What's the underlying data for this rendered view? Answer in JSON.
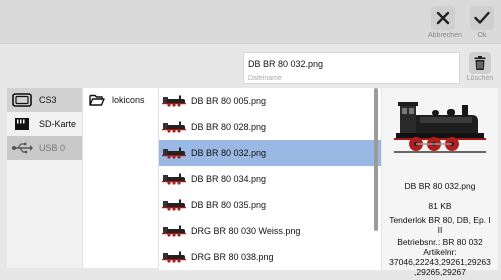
{
  "toolbar": {
    "cancel_label": "Abbrechen",
    "ok_label": "Ok"
  },
  "filename": {
    "value": "DB BR 80 032.png",
    "placeholder": "Dateiname",
    "delete_label": "Löschen"
  },
  "drives": [
    {
      "label": "CS3",
      "icon": "cs3-device-icon",
      "selected": true
    },
    {
      "label": "SD-Karte",
      "icon": "sd-card-icon"
    },
    {
      "label": "USB 0",
      "icon": "usb-icon",
      "disabled": true
    }
  ],
  "folders": [
    {
      "label": "lokicons",
      "icon": "folder-open-icon"
    }
  ],
  "files": [
    {
      "label": "DB BR 80 005.png"
    },
    {
      "label": "DB BR 80 028.png"
    },
    {
      "label": "DB BR 80 032.png",
      "selected": true
    },
    {
      "label": "DB BR 80 034.png"
    },
    {
      "label": "DB BR 80 035.png"
    },
    {
      "label": "DRG BR 80 030 Weiss.png"
    },
    {
      "label": "DRG BR 80 038.png"
    }
  ],
  "preview": {
    "name": "DB BR 80 032.png",
    "size": "81 KB",
    "desc_line1": "Tenderlok BR 80, DB, Ep. I",
    "desc_line2": "II",
    "betriebsnr": "Betriebsnr.: BR 80 032",
    "artikelnr_label": "Artikelnr:",
    "artikelnr_line1": "37046,22243,29261,29263",
    "artikelnr_line2": ",29265,29267"
  },
  "colors": {
    "selection": "#99b9e4",
    "background": "#e7e7e7",
    "toolbar": "#dadada"
  }
}
